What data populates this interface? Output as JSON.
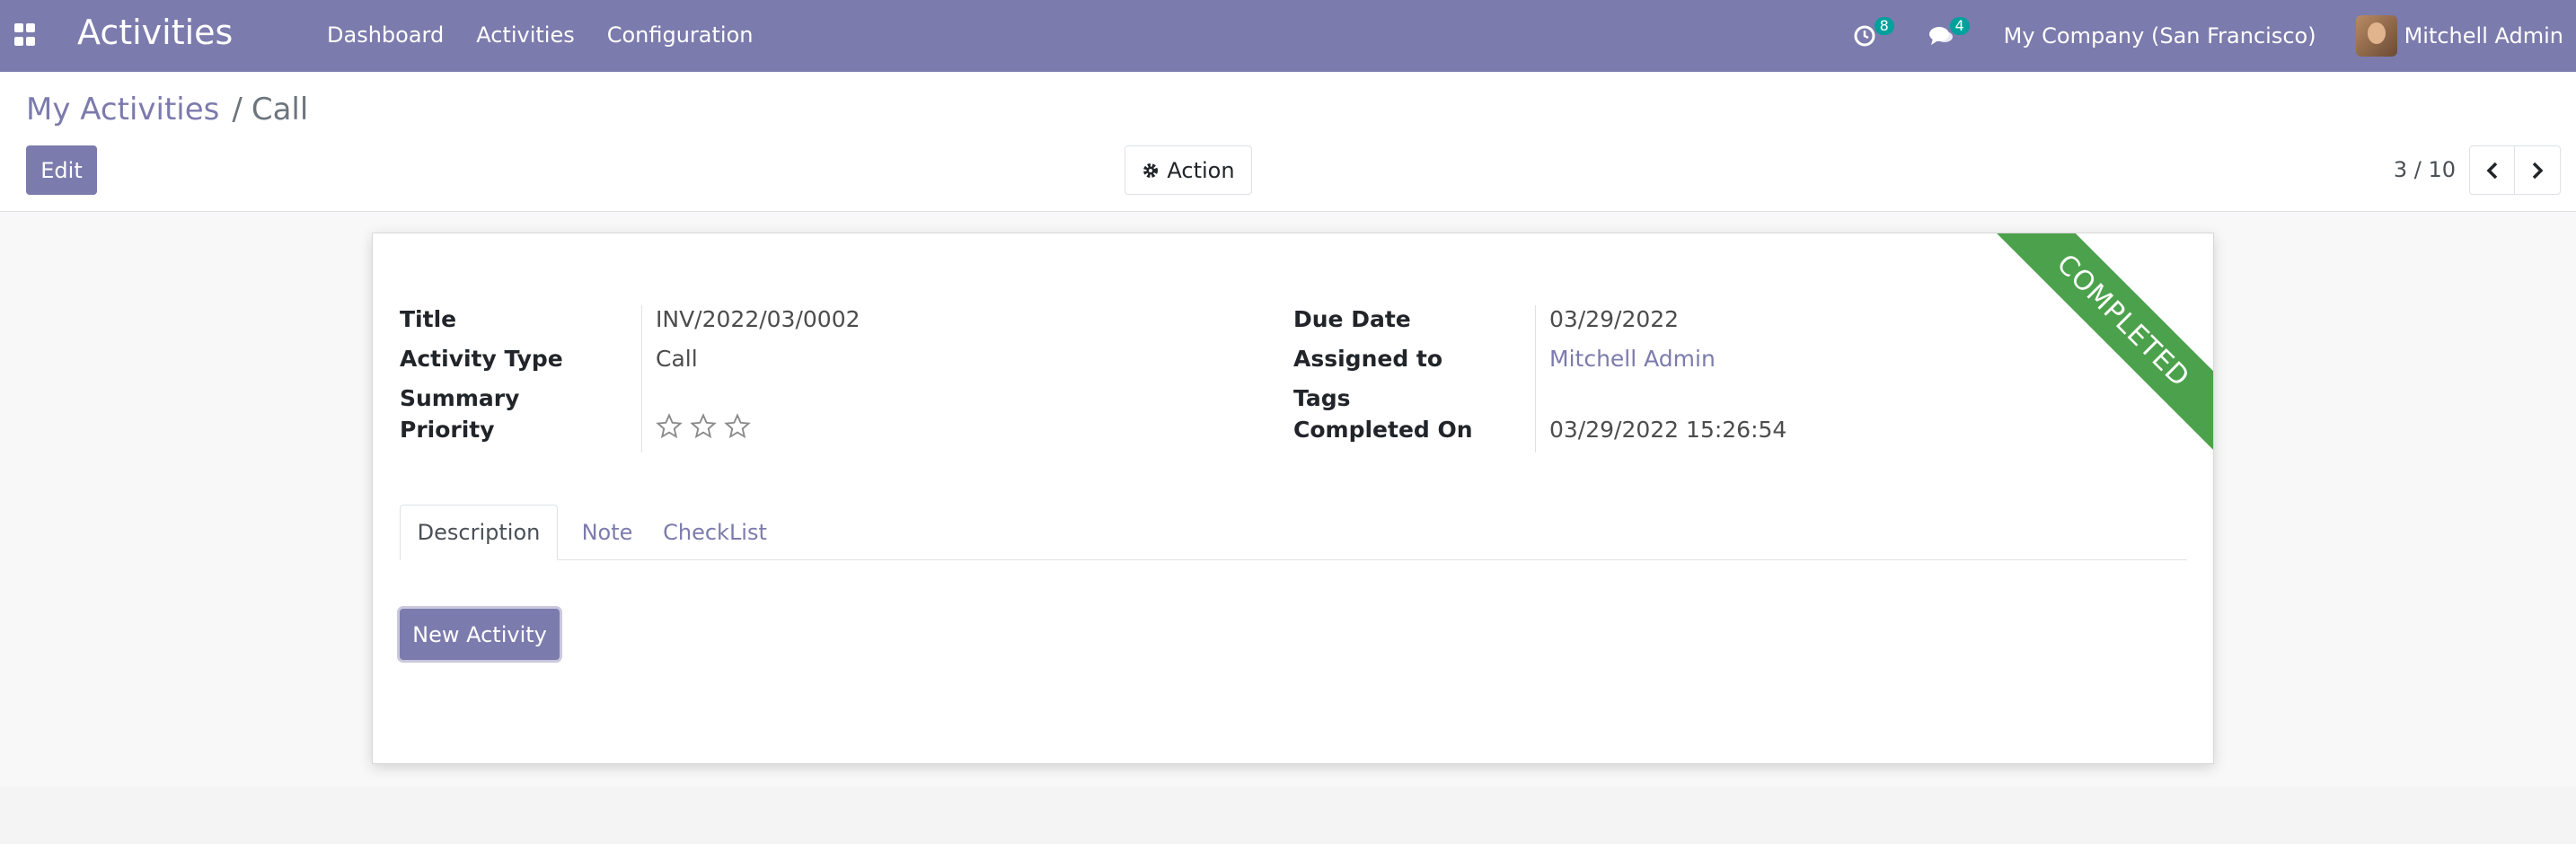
{
  "navbar": {
    "app_title": "Activities",
    "menu": [
      "Dashboard",
      "Activities",
      "Configuration"
    ],
    "activity_count": "8",
    "message_count": "4",
    "company": "My Company (San Francisco)",
    "user": "Mitchell Admin"
  },
  "breadcrumb": {
    "parent": "My Activities",
    "separator": "/",
    "current": "Call"
  },
  "control": {
    "edit_label": "Edit",
    "action_label": "Action",
    "pager": "3 / 10"
  },
  "record": {
    "status_ribbon": "COMPLETED",
    "title_label": "Title",
    "title_value": "INV/2022/03/0002",
    "activity_type_label": "Activity Type",
    "activity_type_value": "Call",
    "summary_label": "Summary",
    "summary_value": "",
    "priority_label": "Priority",
    "priority_value": 0,
    "due_date_label": "Due Date",
    "due_date_value": "03/29/2022",
    "assigned_to_label": "Assigned to",
    "assigned_to_value": "Mitchell Admin",
    "tags_label": "Tags",
    "tags_value": "",
    "completed_on_label": "Completed On",
    "completed_on_value": "03/29/2022 15:26:54"
  },
  "tabs": [
    {
      "label": "Description",
      "active": true
    },
    {
      "label": "Note",
      "active": false
    },
    {
      "label": "CheckList",
      "active": false
    }
  ],
  "description": {
    "new_activity_label": "New Activity"
  },
  "colors": {
    "brand": "#7c7bad",
    "ribbon": "#4ca24c",
    "badge": "#00a09d"
  }
}
